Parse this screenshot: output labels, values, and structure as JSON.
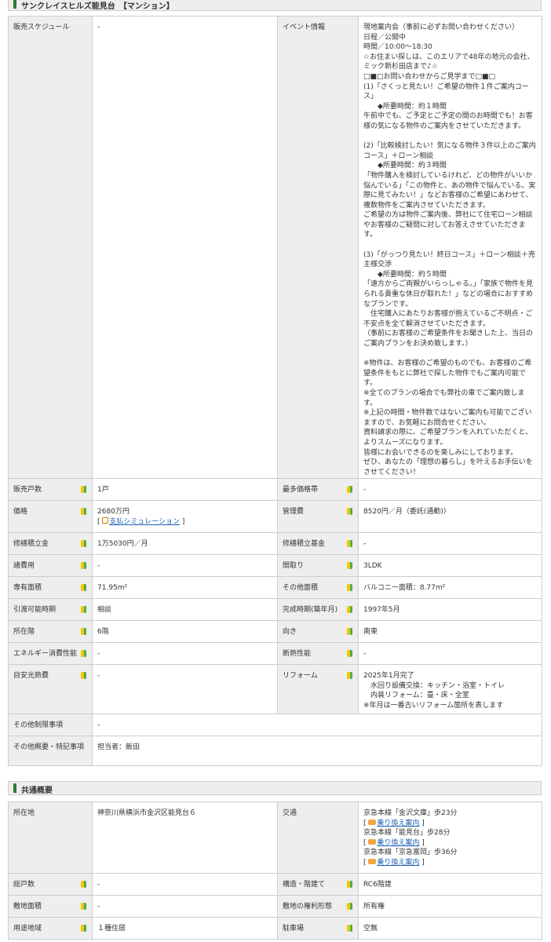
{
  "property_section": {
    "title": "サンクレイスヒルズ能見台　【マンション】",
    "rows": {
      "schedule_label": "販売スケジュール",
      "schedule_value": "-",
      "event_label": "イベント情報",
      "event_value": "現地案内会（事前に必ずお問い合わせください）\n日程／公開中\n時間／10:00～18:30\n☆お住まい探しは、このエリアで48年の地元の会社、ミック新杉田店まで♪☆\n□■□お問い合わせからご見学まで□■□\n(1)「さくっと見たい！ご希望の物件１件ご案内コース」\n　　◆所要時間：約１時間\n午前中でも、ご予定とご予定の間のお時間でも！お客様の気になる物件のご案内をさせていただきます。\n\n(2)「比較検討したい！気になる物件３件以上のご案内コース」＋ローン相談\n　　◆所要時間：約３時間\n「物件購入を検討しているけれど、どの物件がいいか悩んでいる」「この物件と、あの物件で悩んでいる。実際に見てみたい！」などお客様のご希望にあわせて、複数物件をご案内させていただきます。\nご希望の方は物件ご案内後、弊社にて住宅ローン相談やお客様のご疑問に対してお答えさせていただきます。\n\n(3)「がっつり見たい！終日コース」＋ローン相談＋売主様交渉\n　　◆所要時間：約５時間\n「遠方からご両親がいらっしゃる。」「家族で物件を見られる貴重な休日が取れた！」などの場合におすすめなプランです。\n　住宅購入にあたりお客様が抱えているご不明点・ご不安点を全て解消させていただきます。\n（事前にお客様のご希望条件をお聞きした上、当日のご案内プランをお決め致します。）\n\n※物件は、お客様のご希望のものでも、お客様のご希望条件をもとに弊社で探した物件でもご案内可能です。\n※全てのプランの場合でも弊社の車でご案内致します。\n※上記の時間・物件数ではないご案内も可能でございますので、お気軽にお問合せください。\n資料請求の際に、ご希望プランを入れていただくと、よりスムーズになります。\n皆様にお会いできるのを楽しみにしております。\nぜひ、あなたの「理想の暮らし」を叶えるお手伝いをさせてください！",
      "units_label": "販売戸数",
      "units_value": "1戸",
      "top_price_label": "最多価格帯",
      "top_price_value": "-",
      "price_label": "価格",
      "price_value": "2680万円",
      "price_sim_open": "[ ",
      "price_sim_link": "支払シミュレーション",
      "price_sim_close": " ]",
      "mgmt_label": "管理費",
      "mgmt_value": "8520円／月（委託(通勤)）",
      "repair_label": "修繕積立金",
      "repair_value": "1万5030円／月",
      "repair_fund_label": "修繕積立基金",
      "repair_fund_value": "-",
      "fees_label": "諸費用",
      "fees_value": "-",
      "layout_label": "間取り",
      "layout_value": "3LDK",
      "area_label": "専有面積",
      "area_value": "71.95m²",
      "other_area_label": "その他面積",
      "other_area_value": "バルコニー面積：8.77m²",
      "handover_label": "引渡可能時期",
      "handover_value": "相談",
      "built_label": "完成時期(築年月)",
      "built_value": "1997年5月",
      "floor_label": "所在階",
      "floor_value": "6階",
      "direction_label": "向き",
      "direction_value": "南東",
      "energy_label": "エネルギー消費性能",
      "energy_value": "-",
      "insulation_label": "断熱性能",
      "insulation_value": "-",
      "utility_label": "目安光熱費",
      "utility_value": "-",
      "reform_label": "リフォーム",
      "reform_value": "2025年1月完了\n　水回り設備交換：キッチン・浴室・トイレ\n　内装リフォーム：畳・床・全室\n※年月は一番古いリフォーム箇所を表します",
      "restrict_label": "その他制限事項",
      "restrict_value": "-",
      "notes_label": "その他概要・特記事項",
      "notes_value": "担当者：飯田"
    }
  },
  "common_section": {
    "title": "共通概要",
    "rows": {
      "location_label": "所在地",
      "location_value": "神奈川県横浜市金沢区能見台６",
      "transport_label": "交通",
      "transport": [
        {
          "line": "京急本線「金沢文庫」歩23分",
          "link": "乗り換え案内"
        },
        {
          "line": "京急本線「能見台」歩28分",
          "link": "乗り換え案内"
        },
        {
          "line": "京急本線「京急富岡」歩36分",
          "link": "乗り換え案内"
        }
      ],
      "link_open": "[ ",
      "link_close": " ]",
      "total_units_label": "総戸数",
      "total_units_value": "-",
      "structure_label": "構造・階建て",
      "structure_value": "RC6階建",
      "land_area_label": "敷地面積",
      "land_area_value": "-",
      "land_rights_label": "敷地の権利形態",
      "land_rights_value": "所有権",
      "zoning_label": "用途地域",
      "zoning_value": "１種住居",
      "parking_label": "駐車場",
      "parking_value": "空無"
    }
  }
}
